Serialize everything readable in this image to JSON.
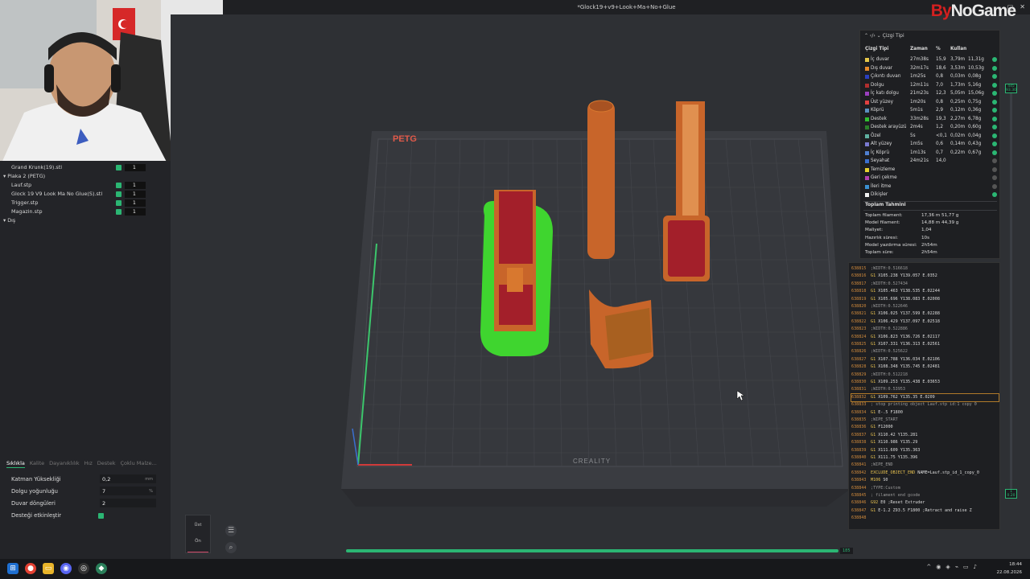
{
  "window": {
    "title": "*Glock19+v9+Look+Ma+No+Glue",
    "controls": [
      "–",
      "▢",
      "✕"
    ]
  },
  "brand": {
    "prefix": "By",
    "name": "NoGame"
  },
  "object_tree": [
    {
      "label": "Grand Krunk(19).stl",
      "indent": 1,
      "checked": true,
      "count": "1"
    },
    {
      "label": "Plaka 2 (PETG)",
      "indent": 0,
      "group": true
    },
    {
      "label": "Lauf.stp",
      "indent": 1,
      "checked": true,
      "count": "1"
    },
    {
      "label": "Glock 19 V9 Look Ma No Glue(S).stl",
      "indent": 1,
      "checked": true,
      "count": "1"
    },
    {
      "label": "Trigger.stp",
      "indent": 1,
      "checked": true,
      "count": "1"
    },
    {
      "label": "Magazin.stp",
      "indent": 1,
      "checked": true,
      "count": "1"
    },
    {
      "label": "Dış",
      "indent": 0,
      "group": true
    }
  ],
  "settings_tabs": [
    "Sıklıkla",
    "Kalite",
    "Dayanıklılık",
    "Hız",
    "Destek",
    "Çoklu Malze..."
  ],
  "settings": [
    {
      "label": "Katman Yüksekliği",
      "value": "0,2",
      "unit": "mm"
    },
    {
      "label": "Dolgu yoğunluğu",
      "value": "7",
      "unit": "%"
    },
    {
      "label": "Duvar döngüleri",
      "value": "2",
      "unit": ""
    },
    {
      "label": "Desteği etkinleştir",
      "value": "",
      "unit": "",
      "toggle": true
    }
  ],
  "plate": {
    "material_label": "PETG",
    "maker_label": "CREALITY"
  },
  "legend": {
    "title": "Çizgi Tipi",
    "headers": {
      "name": "Çizgi Tipi",
      "time": "Zaman",
      "pct": "%",
      "use": "Kullan"
    },
    "rows": [
      {
        "name": "İç duvar",
        "color": "#e6c84a",
        "time": "27m38s",
        "pct": "15,9",
        "m": "3,79m",
        "g": "11,31g",
        "visible": true
      },
      {
        "name": "Dış duvar",
        "color": "#e88a2a",
        "time": "32m17s",
        "pct": "18,6",
        "m": "3,53m",
        "g": "10,53g",
        "visible": true
      },
      {
        "name": "Çıkıntı duvarı",
        "color": "#2a3fbf",
        "time": "1m25s",
        "pct": "0,8",
        "m": "0,03m",
        "g": "0,08g",
        "visible": true
      },
      {
        "name": "Dolgu",
        "color": "#b02e2e",
        "time": "12m11s",
        "pct": "7,0",
        "m": "1,73m",
        "g": "5,16g",
        "visible": true
      },
      {
        "name": "İç katı dolgu",
        "color": "#9a3fbf",
        "time": "21m23s",
        "pct": "12,3",
        "m": "5,05m",
        "g": "15,06g",
        "visible": true
      },
      {
        "name": "Üst yüzey",
        "color": "#e04040",
        "time": "1m20s",
        "pct": "0,8",
        "m": "0,25m",
        "g": "0,75g",
        "visible": true
      },
      {
        "name": "Köprü",
        "color": "#5a8fbf",
        "time": "5m1s",
        "pct": "2,9",
        "m": "0,12m",
        "g": "0,36g",
        "visible": true
      },
      {
        "name": "Destek",
        "color": "#30c030",
        "time": "33m28s",
        "pct": "19,3",
        "m": "2,27m",
        "g": "6,78g",
        "visible": true
      },
      {
        "name": "Destek arayüzü",
        "color": "#2a7f2a",
        "time": "2m4s",
        "pct": "1,2",
        "m": "0,20m",
        "g": "0,60g",
        "visible": true
      },
      {
        "name": "Özel",
        "color": "#5fb0a0",
        "time": "5s",
        "pct": "<0,1",
        "m": "0,02m",
        "g": "0,04g",
        "visible": true
      },
      {
        "name": "Alt yüzey",
        "color": "#7a7ad0",
        "time": "1m5s",
        "pct": "0,6",
        "m": "0,14m",
        "g": "0,43g",
        "visible": true
      },
      {
        "name": "İç Köprü",
        "color": "#4f7fd0",
        "time": "1m13s",
        "pct": "0,7",
        "m": "0,22m",
        "g": "0,67g",
        "visible": true
      },
      {
        "name": "Seyahat",
        "color": "#3a6fd0",
        "time": "24m21s",
        "pct": "14,0",
        "m": "",
        "g": "",
        "visible": false
      },
      {
        "name": "Temizleme",
        "color": "#e6d030",
        "time": "",
        "pct": "",
        "m": "",
        "g": "",
        "visible": false
      },
      {
        "name": "Geri çekme",
        "color": "#b03fb0",
        "time": "",
        "pct": "",
        "m": "",
        "g": "",
        "visible": false
      },
      {
        "name": "İleri itme",
        "color": "#3a8fd0",
        "time": "",
        "pct": "",
        "m": "",
        "g": "",
        "visible": false
      },
      {
        "name": "Dikişler",
        "color": "#f0f0f0",
        "time": "",
        "pct": "",
        "m": "",
        "g": "",
        "visible": true
      }
    ],
    "totals_title": "Toplam Tahmini",
    "totals": [
      {
        "k": "Toplam filament:",
        "v": "17,36 m      51,77 g"
      },
      {
        "k": "Model filament:",
        "v": "14,88 m      44,39 g"
      },
      {
        "k": "Maliyet:",
        "v": "1,04"
      },
      {
        "k": "Hazırlık süresi:",
        "v": "10s"
      },
      {
        "k": "Model yazdırma süresi:",
        "v": "2h54m"
      },
      {
        "k": "Toplam süre:",
        "v": "2h54m"
      }
    ]
  },
  "gcode": [
    {
      "ln": "638815",
      "cmd": "",
      "txt": ";WIDTH:0.516618"
    },
    {
      "ln": "638816",
      "cmd": "G1",
      "txt": "X105.238 Y139.057 E.0352"
    },
    {
      "ln": "638817",
      "cmd": "",
      "txt": ";WIDTH:0.527434"
    },
    {
      "ln": "638818",
      "cmd": "G1",
      "txt": "X105.463 Y138.535 E.02244"
    },
    {
      "ln": "638819",
      "cmd": "G1",
      "txt": "X105.696 Y138.083 E.02008"
    },
    {
      "ln": "638820",
      "cmd": "",
      "txt": ";WIDTH:0.522646"
    },
    {
      "ln": "638821",
      "cmd": "G1",
      "txt": "X106.025 Y137.599 E.02288"
    },
    {
      "ln": "638822",
      "cmd": "G1",
      "txt": "X106.429 Y137.097 E.02518"
    },
    {
      "ln": "638823",
      "cmd": "",
      "txt": ";WIDTH:0.522886"
    },
    {
      "ln": "638824",
      "cmd": "G1",
      "txt": "X106.823 Y136.726 E.02117"
    },
    {
      "ln": "638825",
      "cmd": "G1",
      "txt": "X107.331 Y136.313 E.02561"
    },
    {
      "ln": "638826",
      "cmd": "",
      "txt": ";WIDTH:0.525622"
    },
    {
      "ln": "638827",
      "cmd": "G1",
      "txt": "X107.788 Y136.034 E.02106"
    },
    {
      "ln": "638828",
      "cmd": "G1",
      "txt": "X108.348 Y135.745 E.02481"
    },
    {
      "ln": "638829",
      "cmd": "",
      "txt": ";WIDTH:0.512218"
    },
    {
      "ln": "638830",
      "cmd": "G1",
      "txt": "X109.253 Y135.438 E.03653"
    },
    {
      "ln": "638831",
      "cmd": "",
      "txt": ";WIDTH:0.53953"
    },
    {
      "ln": "638832",
      "cmd": "G1",
      "txt": "X109.762 Y135.35 E.0209",
      "highlight": true
    },
    {
      "ln": "638833",
      "cmd": "",
      "txt": "; stop printing object Lauf.stp id:1 copy 0"
    },
    {
      "ln": "638834",
      "cmd": "G1",
      "txt": "E-.5 F1800"
    },
    {
      "ln": "638835",
      "cmd": "",
      "txt": ";WIPE_START"
    },
    {
      "ln": "638836",
      "cmd": "G1",
      "txt": "F12000"
    },
    {
      "ln": "638837",
      "cmd": "G1",
      "txt": "X110.42 Y135.281"
    },
    {
      "ln": "638838",
      "cmd": "G1",
      "txt": "X110.986 Y135.29"
    },
    {
      "ln": "638839",
      "cmd": "G1",
      "txt": "X111.609 Y135.363"
    },
    {
      "ln": "638840",
      "cmd": "G1",
      "txt": "X111.75 Y135.396"
    },
    {
      "ln": "638841",
      "cmd": "",
      "txt": ";WIPE_END"
    },
    {
      "ln": "638842",
      "cmd": "EXCLUDE_OBJECT_END",
      "txt": "NAME=Lauf.stp_id_1_copy_0"
    },
    {
      "ln": "638843",
      "cmd": "M106",
      "txt": "S0"
    },
    {
      "ln": "638844",
      "cmd": "",
      "txt": ";TYPE:Custom"
    },
    {
      "ln": "638845",
      "cmd": "",
      "txt": "; filament end gcode"
    },
    {
      "ln": "638846",
      "cmd": "G92",
      "txt": "E0 ;Reset Extruder"
    },
    {
      "ln": "638847",
      "cmd": "G1",
      "txt": "E-1.2 Z93.5 F1800 ;Retract and raise Z"
    },
    {
      "ln": "638848",
      "cmd": "",
      "txt": ""
    }
  ],
  "sliders": {
    "layer_top": "445",
    "layer_top_z": "93.30",
    "layer_bottom": "1",
    "layer_bottom_z": "0.20",
    "move_value": "185",
    "move_progress": 0.99
  },
  "view_buttons": {
    "top": "Üst",
    "bottom": "Ön"
  },
  "clock": {
    "time": "18:44",
    "date": "22.08.2026"
  }
}
